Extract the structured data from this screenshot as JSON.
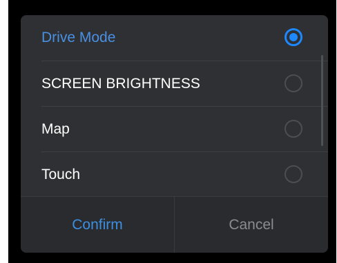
{
  "dialog": {
    "options": [
      {
        "label": "Drive Mode",
        "selected": true
      },
      {
        "label": "SCREEN BRIGHTNESS",
        "selected": false
      },
      {
        "label": "Map",
        "selected": false
      },
      {
        "label": "Touch",
        "selected": false
      }
    ],
    "confirm_label": "Confirm",
    "cancel_label": "Cancel"
  },
  "colors": {
    "accent": "#1e88ff",
    "dialog_bg": "#2f3033",
    "text": "#ffffff",
    "muted_text": "#8b8c90"
  },
  "icons": {
    "selected_radio": "radio-selected-icon",
    "unselected_radio": "radio-unselected-icon"
  }
}
